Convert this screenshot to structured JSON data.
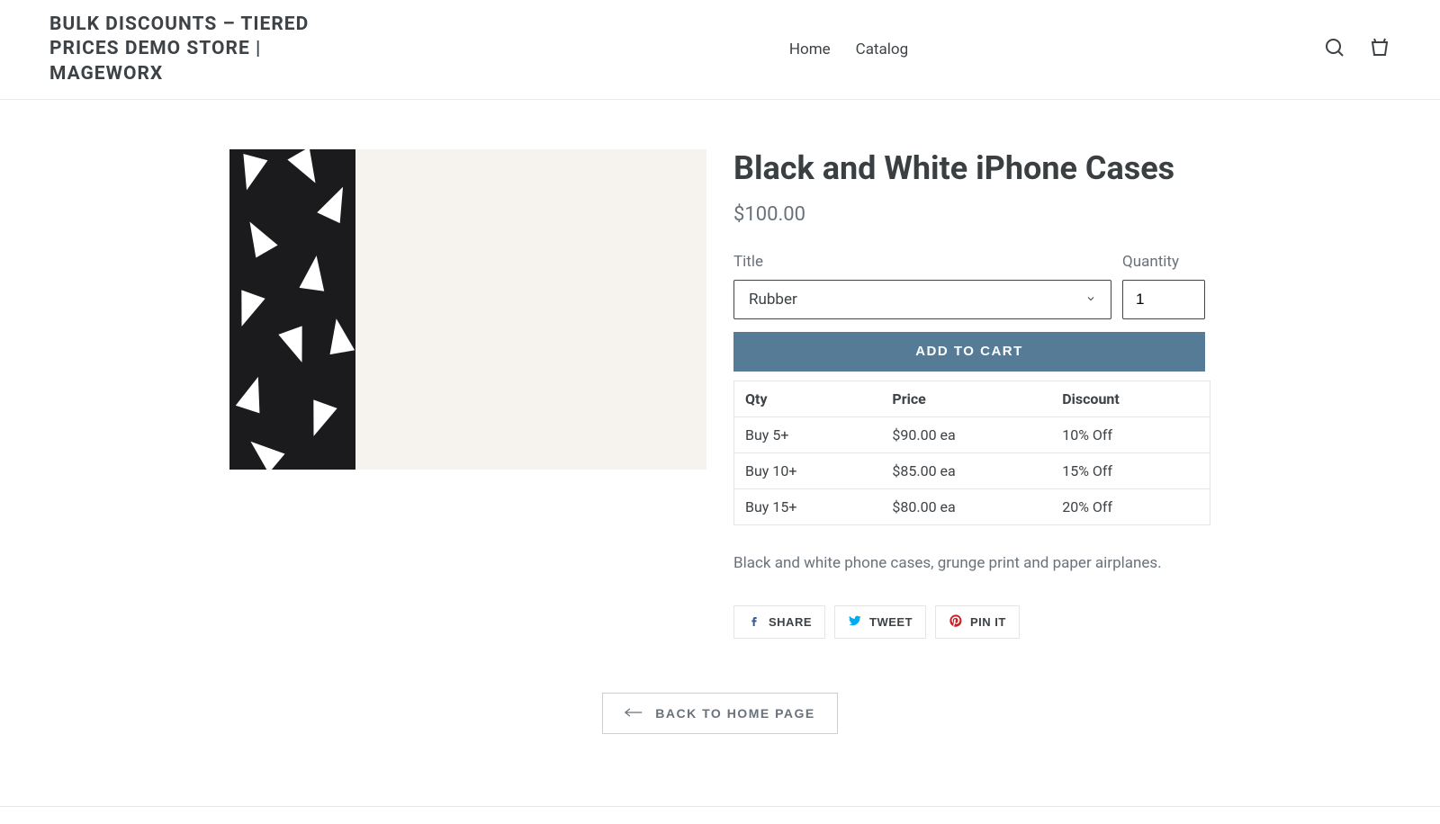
{
  "header": {
    "site_title": "BULK DISCOUNTS – TIERED PRICES DEMO STORE | MAGEWORX",
    "nav": {
      "home": "Home",
      "catalog": "Catalog"
    },
    "icons": {
      "search": "Submit",
      "cart": "Cart"
    }
  },
  "product": {
    "title": "Black and White iPhone Cases",
    "price": "$100.00",
    "variant_label": "Title",
    "variant_value": "Rubber",
    "quantity_label": "Quantity",
    "quantity_value": "1",
    "add_to_cart": "ADD TO CART",
    "description": "Black and white phone cases, grunge print and paper airplanes."
  },
  "discount_table": {
    "headers": {
      "qty": "Qty",
      "price": "Price",
      "discount": "Discount"
    },
    "rows": [
      {
        "qty": "Buy 5+",
        "price": "$90.00 ea",
        "discount": "10% Off"
      },
      {
        "qty": "Buy 10+",
        "price": "$85.00 ea",
        "discount": "15% Off"
      },
      {
        "qty": "Buy 15+",
        "price": "$80.00 ea",
        "discount": "20% Off"
      }
    ]
  },
  "share": {
    "facebook": "SHARE",
    "twitter": "TWEET",
    "pinterest": "PIN IT"
  },
  "back_link": "BACK TO HOME PAGE"
}
